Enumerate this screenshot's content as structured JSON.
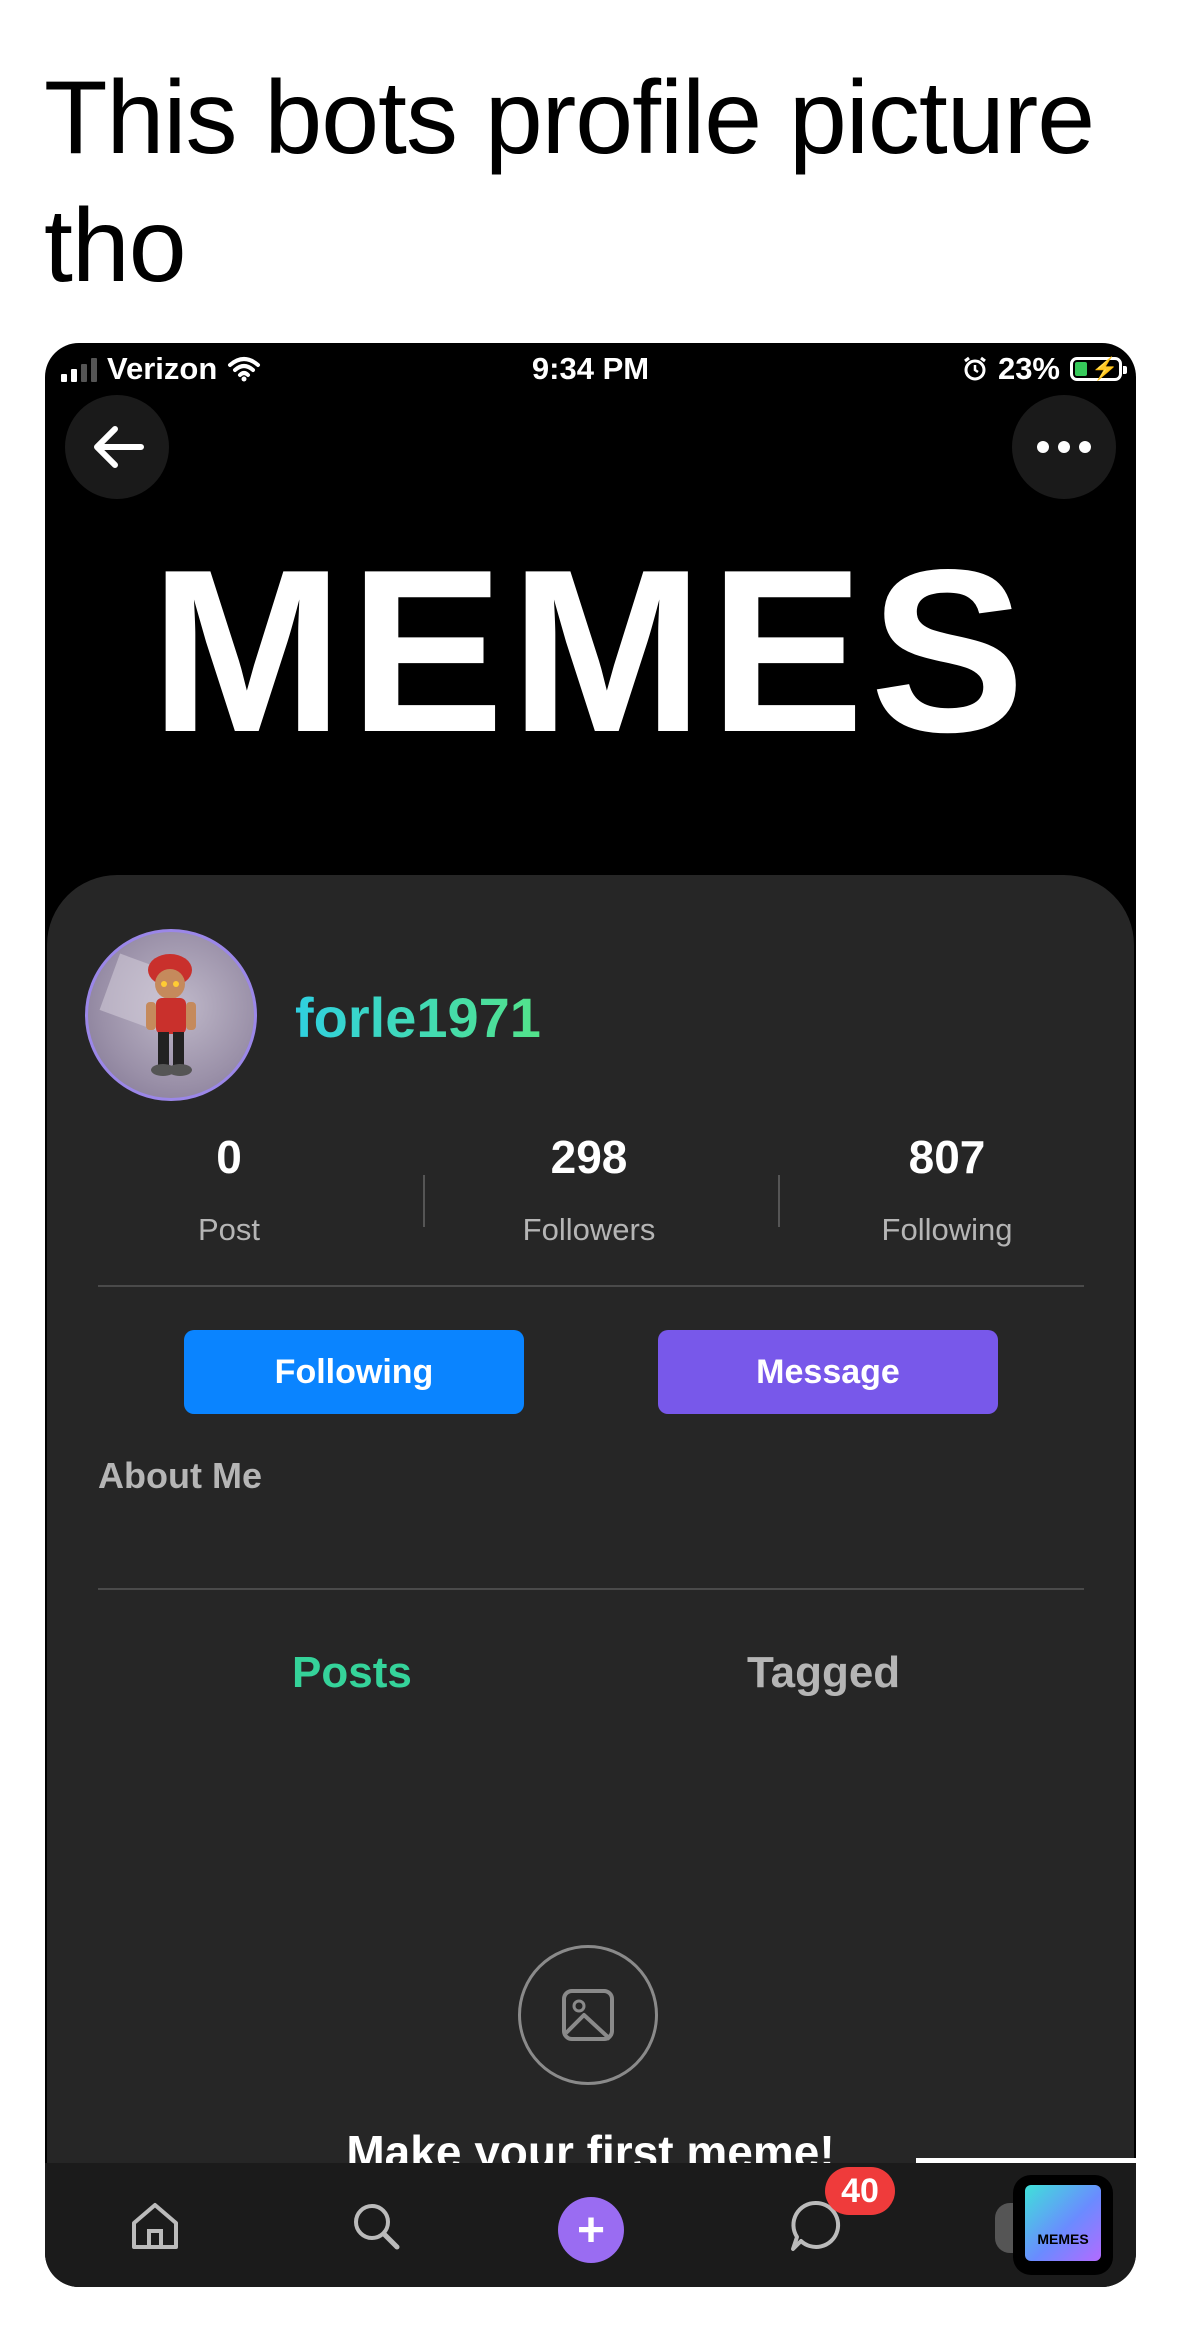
{
  "caption": "This bots profile picture tho",
  "status_bar": {
    "carrier": "Verizon",
    "time": "9:34 PM",
    "battery": "23%"
  },
  "banner": {
    "title": "MEMES"
  },
  "profile": {
    "username": "forle1971",
    "stats": [
      {
        "value": "0",
        "label": "Post"
      },
      {
        "value": "298",
        "label": "Followers"
      },
      {
        "value": "807",
        "label": "Following"
      }
    ],
    "following_button": "Following",
    "message_button": "Message",
    "about_heading": "About Me"
  },
  "tabs": {
    "posts": "Posts",
    "tagged": "Tagged"
  },
  "empty_state": {
    "text": "Make your first meme!"
  },
  "tab_bar": {
    "messages_badge": "40",
    "app_icon_label": "MEMES"
  },
  "colors": {
    "following_button": "#0a84ff",
    "message_button": "#7858ea",
    "active_tab": "#35d39a",
    "badge": "#ef3b3b"
  }
}
